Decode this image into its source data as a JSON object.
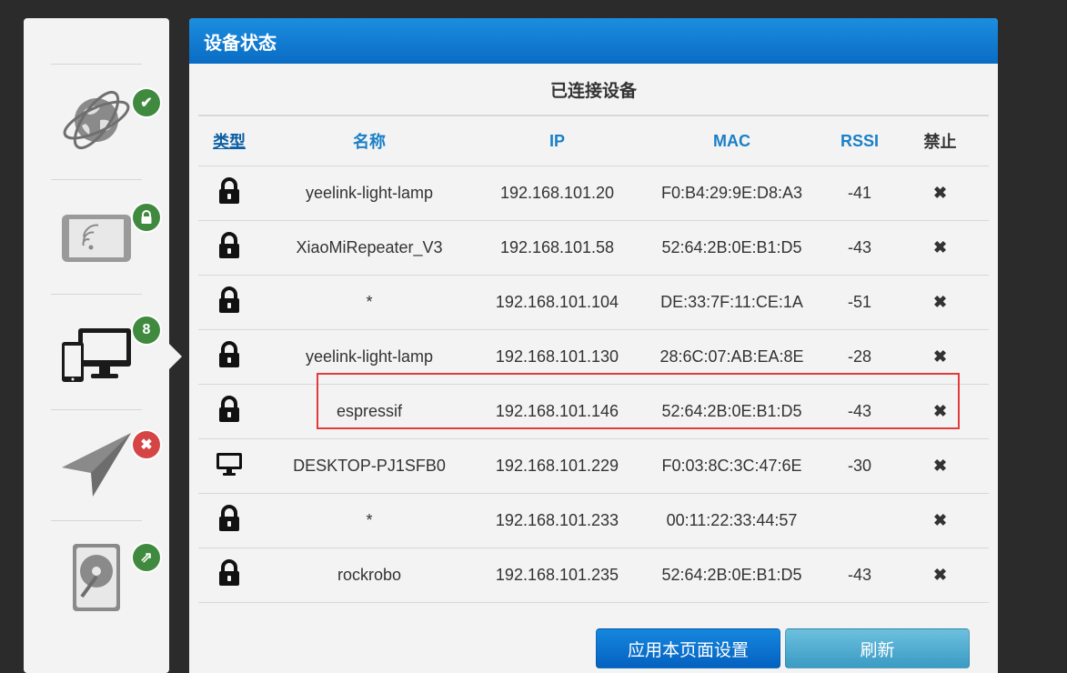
{
  "sidebar": {
    "items": [
      {
        "icon": "globe-icon",
        "badge_icon": "check-icon",
        "status": "ok"
      },
      {
        "icon": "tablet-wifi-icon",
        "badge_icon": "lock-icon",
        "status": "secured"
      },
      {
        "icon": "devices-icon",
        "badge": "8",
        "status": "active"
      },
      {
        "icon": "paper-plane-icon",
        "badge_icon": "close-icon",
        "status": "error"
      },
      {
        "icon": "hard-drive-icon",
        "badge_icon": "share-icon",
        "status": "external"
      }
    ]
  },
  "panel": {
    "title": "设备状态",
    "section_title": "已连接设备"
  },
  "table": {
    "headers": {
      "type": "类型",
      "name": "名称",
      "ip": "IP",
      "mac": "MAC",
      "rssi": "RSSI",
      "ban": "禁止"
    },
    "rows": [
      {
        "type_icon": "lock-icon",
        "name": "yeelink-light-lamp",
        "ip": "192.168.101.20",
        "mac": "F0:B4:29:9E:D8:A3",
        "rssi": "-41",
        "ban": "✖"
      },
      {
        "type_icon": "lock-icon",
        "name": "XiaoMiRepeater_V3",
        "ip": "192.168.101.58",
        "mac": "52:64:2B:0E:B1:D5",
        "rssi": "-43",
        "ban": "✖"
      },
      {
        "type_icon": "lock-icon",
        "name": "*",
        "ip": "192.168.101.104",
        "mac": "DE:33:7F:11:CE:1A",
        "rssi": "-51",
        "ban": "✖"
      },
      {
        "type_icon": "lock-icon",
        "name": "yeelink-light-lamp",
        "ip": "192.168.101.130",
        "mac": "28:6C:07:AB:EA:8E",
        "rssi": "-28",
        "ban": "✖"
      },
      {
        "type_icon": "lock-icon",
        "name": "espressif",
        "ip": "192.168.101.146",
        "mac": "52:64:2B:0E:B1:D5",
        "rssi": "-43",
        "ban": "✖"
      },
      {
        "type_icon": "monitor-icon",
        "name": "DESKTOP-PJ1SFB0",
        "ip": "192.168.101.229",
        "mac": "F0:03:8C:3C:47:6E",
        "rssi": "-30",
        "ban": "✖"
      },
      {
        "type_icon": "lock-icon",
        "name": "*",
        "ip": "192.168.101.233",
        "mac": "00:11:22:33:44:57",
        "rssi": "",
        "ban": "✖"
      },
      {
        "type_icon": "lock-icon",
        "name": "rockrobo",
        "ip": "192.168.101.235",
        "mac": "52:64:2B:0E:B1:D5",
        "rssi": "-43",
        "ban": "✖"
      }
    ]
  },
  "buttons": {
    "apply": "应用本页面设置",
    "refresh": "刷新"
  },
  "colors": {
    "header_blue": "#0a6cc4",
    "link_blue": "#1a7fc7",
    "badge_green": "#3f8a3f",
    "badge_red": "#d64545",
    "highlight_red": "#e23b3b"
  }
}
